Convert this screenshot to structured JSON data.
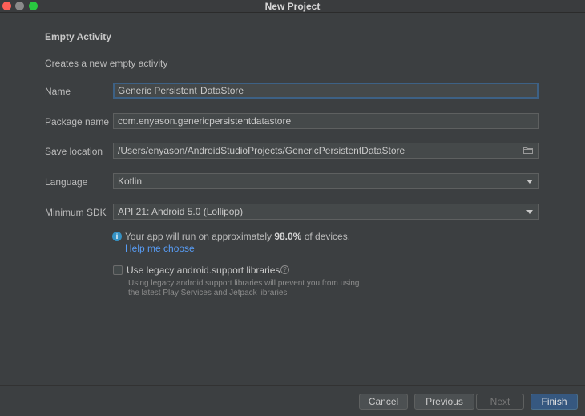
{
  "window": {
    "title": "New Project"
  },
  "header": {
    "section_title": "Empty Activity",
    "description": "Creates a new empty activity"
  },
  "form": {
    "name": {
      "label": "Name",
      "value_before_caret": "Generic Persistent ",
      "value_after_caret": "DataStore"
    },
    "package_name": {
      "label": "Package name",
      "value": "com.enyason.genericpersistentdatastore"
    },
    "save_location": {
      "label": "Save location",
      "value": "/Users/enyason/AndroidStudioProjects/GenericPersistentDataStore",
      "icon": "folder-icon"
    },
    "language": {
      "label": "Language",
      "selected": "Kotlin"
    },
    "minimum_sdk": {
      "label": "Minimum SDK",
      "selected": "API 21: Android 5.0 (Lollipop)"
    }
  },
  "info": {
    "icon": "info-icon",
    "text_prefix": "Your app will run on approximately ",
    "percentage": "98.0%",
    "text_suffix": " of devices.",
    "help_link": "Help me choose"
  },
  "legacy": {
    "checked": false,
    "label": "Use legacy android.support libraries",
    "help_icon": "question-icon",
    "hint_line1": "Using legacy android.support libraries will prevent you from using",
    "hint_line2": "the latest Play Services and Jetpack libraries"
  },
  "buttons": {
    "cancel": "Cancel",
    "previous": "Previous",
    "next": "Next",
    "finish": "Finish"
  },
  "colors": {
    "background": "#3c3f41",
    "field": "#45494a",
    "focus_border": "#3d6185",
    "link": "#589df6",
    "primary_button": "#365880",
    "info_icon": "#3592c4"
  }
}
